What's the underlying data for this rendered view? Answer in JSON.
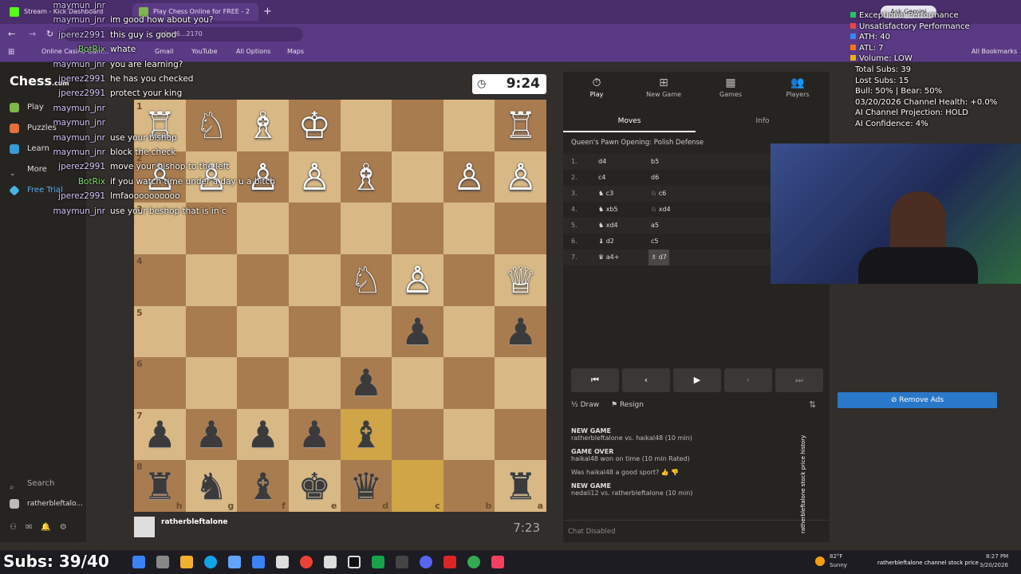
{
  "browser": {
    "tabs": [
      {
        "label": "Stream - Kick Dashboard"
      },
      {
        "label": "Play Chess Online for FREE - 2"
      }
    ],
    "address": "n/mn6...2170",
    "bookmarks": [
      "Online Casino Gam...",
      "Gmail",
      "YouTube",
      "All Options",
      "Maps"
    ],
    "all_bookmarks": "All Bookmarks",
    "ask_gemini": "Ask Gemini"
  },
  "nav": {
    "logo": "Chess",
    "logo_suffix": ".com",
    "items": [
      "Play",
      "Puzzles",
      "Learn",
      "More",
      "Free Trial"
    ],
    "search": "Search",
    "user": "ratherbleftalo..."
  },
  "board": {
    "opponent_name": "ratherbleftalone",
    "opponent_time": "9:24",
    "player_time": "7:23",
    "ranks": [
      "1",
      "2",
      "3",
      "4",
      "5",
      "6",
      "7",
      "8"
    ],
    "files": [
      "h",
      "g",
      "f",
      "e",
      "d",
      "c",
      "b",
      "a"
    ],
    "rows": [
      [
        "wR",
        "wN",
        "wB",
        "wK",
        "",
        "",
        "",
        "wR"
      ],
      [
        "wP",
        "wP",
        "wP",
        "wP",
        "wB",
        "",
        "wP",
        "wP"
      ],
      [
        "",
        "",
        "",
        "",
        "",
        "",
        "",
        ""
      ],
      [
        "",
        "",
        "",
        "",
        "wN",
        "wP",
        "",
        "wQ"
      ],
      [
        "",
        "",
        "",
        "",
        "",
        "bP",
        "",
        "bP"
      ],
      [
        "",
        "",
        "",
        "",
        "bP",
        "",
        "",
        ""
      ],
      [
        "bP",
        "bP",
        "bP",
        "bP",
        "bB",
        "",
        "",
        ""
      ],
      [
        "bR",
        "bN",
        "bB",
        "bK",
        "bQ",
        "",
        "",
        "bR"
      ]
    ],
    "highlight": [
      [
        6,
        4
      ],
      [
        7,
        5
      ]
    ]
  },
  "panel": {
    "tabs": [
      {
        "label": "Play",
        "icon": "stopwatch-icon",
        "glyph": "⏱"
      },
      {
        "label": "New Game",
        "icon": "plus-icon",
        "glyph": "⊞"
      },
      {
        "label": "Games",
        "icon": "board-icon",
        "glyph": "▦"
      },
      {
        "label": "Players",
        "icon": "players-icon",
        "glyph": "👥"
      }
    ],
    "subtabs": [
      "Moves",
      "Info"
    ],
    "opening": "Queen's Pawn Opening: Polish Defense",
    "moves": [
      {
        "n": "1.",
        "w": "d4",
        "b": "b5"
      },
      {
        "n": "2.",
        "w": "c4",
        "b": "d6"
      },
      {
        "n": "3.",
        "w": "♞ c3",
        "b": "♘ c6"
      },
      {
        "n": "4.",
        "w": "♞ xb5",
        "b": "♘ xd4"
      },
      {
        "n": "5.",
        "w": "♞ xd4",
        "b": "a5"
      },
      {
        "n": "6.",
        "w": "♝ d2",
        "b": "c5"
      },
      {
        "n": "7.",
        "w": "♛ a4+",
        "b": "♗ d7"
      }
    ],
    "draw": "Draw",
    "resign": "Resign",
    "log": [
      {
        "title": "NEW GAME",
        "text": "ratherbleftalone vs. haikal48 (10 min)"
      },
      {
        "title": "GAME OVER",
        "text": "haikal48 won on time (10 min Rated)"
      },
      {
        "title": "",
        "text": "Was haikal48 a good sport?"
      },
      {
        "title": "NEW GAME",
        "text": "nedali12 vs. ratherbleftalone (10 min)"
      }
    ],
    "chat_disabled": "Chat Disabled"
  },
  "chat": [
    {
      "user": "maymun_jnr",
      "msg": ""
    },
    {
      "user": "maymun_jnr",
      "msg": "im good how about you?"
    },
    {
      "user": "jperez2991",
      "msg": "this guy is good"
    },
    {
      "user": "BotRix",
      "msg": "whate"
    },
    {
      "user": "maymun_jnr",
      "msg": "you are learning?"
    },
    {
      "user": "jperez2991",
      "msg": "he has you checked"
    },
    {
      "user": "jperez2991",
      "msg": "protect your king"
    },
    {
      "user": "maymun_jnr",
      "msg": ""
    },
    {
      "user": "maymun_jnr",
      "msg": ""
    },
    {
      "user": "maymun_jnr",
      "msg": "use your bishop"
    },
    {
      "user": "maymun_jnr",
      "msg": "block the check"
    },
    {
      "user": "jperez2991",
      "msg": "move your bishop to the left"
    },
    {
      "user": "BotRix",
      "msg": "if you watch time under a day u a bitch"
    },
    {
      "user": "jperez2991",
      "msg": "lmfaoooooooooo"
    },
    {
      "user": "maymun_jnr",
      "msg": "use your beshop that is in c"
    }
  ],
  "overlay": {
    "stats": [
      {
        "text": "Exceptional Performance",
        "color": "#22c55e"
      },
      {
        "text": "Unsatisfactory Performance",
        "color": "#ef4444"
      },
      {
        "text": "ATH: 40",
        "color": "#3b82f6"
      },
      {
        "text": "ATL: 7",
        "color": "#f97316"
      },
      {
        "text": "Volume: LOW",
        "color": "#eab308"
      },
      {
        "text": "Total Subs: 39",
        "color": ""
      },
      {
        "text": "Lost Subs: 15",
        "color": ""
      },
      {
        "text": "Bull: 50% | Bear: 50%",
        "color": ""
      },
      {
        "text": "03/20/2026 Channel Health: +0.0%",
        "color": ""
      },
      {
        "text": "AI Channel Projection: HOLD",
        "color": ""
      },
      {
        "text": "AI Confidence: 4%",
        "color": ""
      }
    ],
    "remove_ads": "Remove Ads",
    "subs": "Subs: 39/40",
    "vertical_caption": "ratherbleftalone stock price history"
  },
  "taskbar": {
    "weather_temp": "82°F",
    "weather_desc": "Sunny",
    "time": "8:27 PM",
    "date": "3/20/2026",
    "ticker": "ratherbleftalone channel stock price"
  },
  "colors": {
    "board_light": "#d8b884",
    "board_dark": "#a97c50",
    "highlight": "#cfa548",
    "accent_blue": "#2a78c9",
    "chrome_purple": "#5b3a85"
  }
}
